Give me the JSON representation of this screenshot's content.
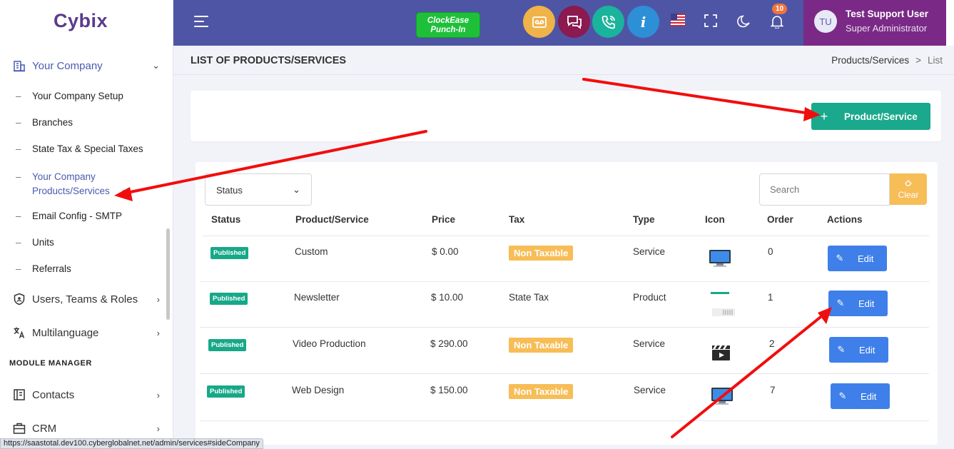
{
  "brand": {
    "logo": "Cybix"
  },
  "sidebar": {
    "company": {
      "label": "Your Company"
    },
    "children": [
      {
        "label": "Your Company Setup"
      },
      {
        "label": "Branches"
      },
      {
        "label": "State Tax & Special Taxes"
      },
      {
        "label": "Your Company Products/Services"
      },
      {
        "label": "Email Config - SMTP"
      },
      {
        "label": "Units"
      },
      {
        "label": "Referrals"
      }
    ],
    "users": {
      "label": "Users, Teams & Roles"
    },
    "multilanguage": {
      "label": "Multilanguage"
    },
    "module_title": "MODULE MANAGER",
    "contacts": {
      "label": "Contacts"
    },
    "crm": {
      "label": "CRM"
    }
  },
  "topbar": {
    "clock_line1": "ClockEase",
    "clock_line2": "Punch-In",
    "info_glyph": "i",
    "notif_count": "10",
    "user": {
      "initials": "TU",
      "name": "Test Support User",
      "role": "Super Administrator"
    }
  },
  "page": {
    "title": "LIST OF PRODUCTS/SERVICES",
    "breadcrumb": {
      "parent": "Products/Services",
      "sep": ">",
      "current": "List"
    },
    "add_button": "Product/Service"
  },
  "filters": {
    "status_select": "Status",
    "search_placeholder": "Search",
    "clear_label": "Clear"
  },
  "table": {
    "columns": [
      "Status",
      "Product/Service",
      "Price",
      "Tax",
      "Type",
      "Icon",
      "Order",
      "Actions"
    ],
    "rows": [
      {
        "status": "Published",
        "name": "Custom",
        "price": "$ 0.00",
        "tax": "Non Taxable",
        "tax_badge": true,
        "type": "Service",
        "icon": "monitor-icon",
        "order": "0",
        "action": "Edit"
      },
      {
        "status": "Published",
        "name": "Newsletter",
        "price": "$ 10.00",
        "tax": "State Tax",
        "tax_badge": false,
        "type": "Product",
        "icon": "newsletter-icon",
        "order": "1",
        "action": "Edit"
      },
      {
        "status": "Published",
        "name": "Video Production",
        "price": "$ 290.00",
        "tax": "Non Taxable",
        "tax_badge": true,
        "type": "Service",
        "icon": "clapperboard-icon",
        "order": "2",
        "action": "Edit"
      },
      {
        "status": "Published",
        "name": "Web Design",
        "price": "$ 150.00",
        "tax": "Non Taxable",
        "tax_badge": true,
        "type": "Service",
        "icon": "monitor-icon",
        "order": "7",
        "action": "Edit"
      }
    ]
  },
  "statusbar": {
    "url": "https://saastotal.dev100.cyberglobalnet.net/admin/services#sideCompany"
  },
  "colors": {
    "topbar": "#4f55a5",
    "accent_green": "#1aa98c",
    "edit_blue": "#3f7fe9",
    "badge_yellow": "#f7bd57"
  }
}
